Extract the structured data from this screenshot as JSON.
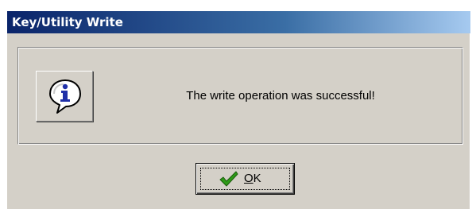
{
  "window": {
    "title": "Key/Utility Write"
  },
  "dialog": {
    "icon": "information-icon",
    "message": "The write operation was successful!"
  },
  "ok_button": {
    "icon": "check-icon",
    "mnemonic": "O",
    "label_rest": "K"
  },
  "colors": {
    "title_bar_start": "#0a246a",
    "title_bar_end": "#a6caf0",
    "dialog_face": "#d4d0c8",
    "check_green": "#2e9a18",
    "info_blue": "#1f2fa8"
  }
}
